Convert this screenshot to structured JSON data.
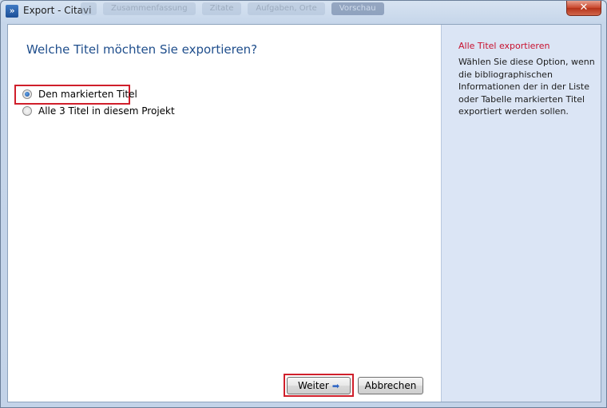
{
  "window": {
    "title": "Export - Citavi",
    "icon": "citavi-app-icon",
    "background_tabs": [
      "",
      "Zusammenfassung",
      "Zitate",
      "Aufgaben, Orte",
      "Vorschau"
    ]
  },
  "main": {
    "question": "Welche Titel möchten Sie exportieren?",
    "options": [
      {
        "label": "Den markierten Titel",
        "selected": true
      },
      {
        "label": "Alle 3 Titel in diesem Projekt",
        "selected": false
      }
    ]
  },
  "side": {
    "title": "Alle Titel exportieren",
    "text": "Wählen Sie diese Option, wenn die bibliographischen Informationen der in der Liste oder Tabelle markierten Titel exportiert werden sollen."
  },
  "buttons": {
    "next_label": "Weiter",
    "next_icon": "arrow-right-icon",
    "cancel_label": "Abbrechen"
  },
  "colors": {
    "question": "#1f4e8c",
    "side_title": "#c8102e",
    "side_background": "#dbe5f5",
    "highlight": "#d01f2b"
  }
}
